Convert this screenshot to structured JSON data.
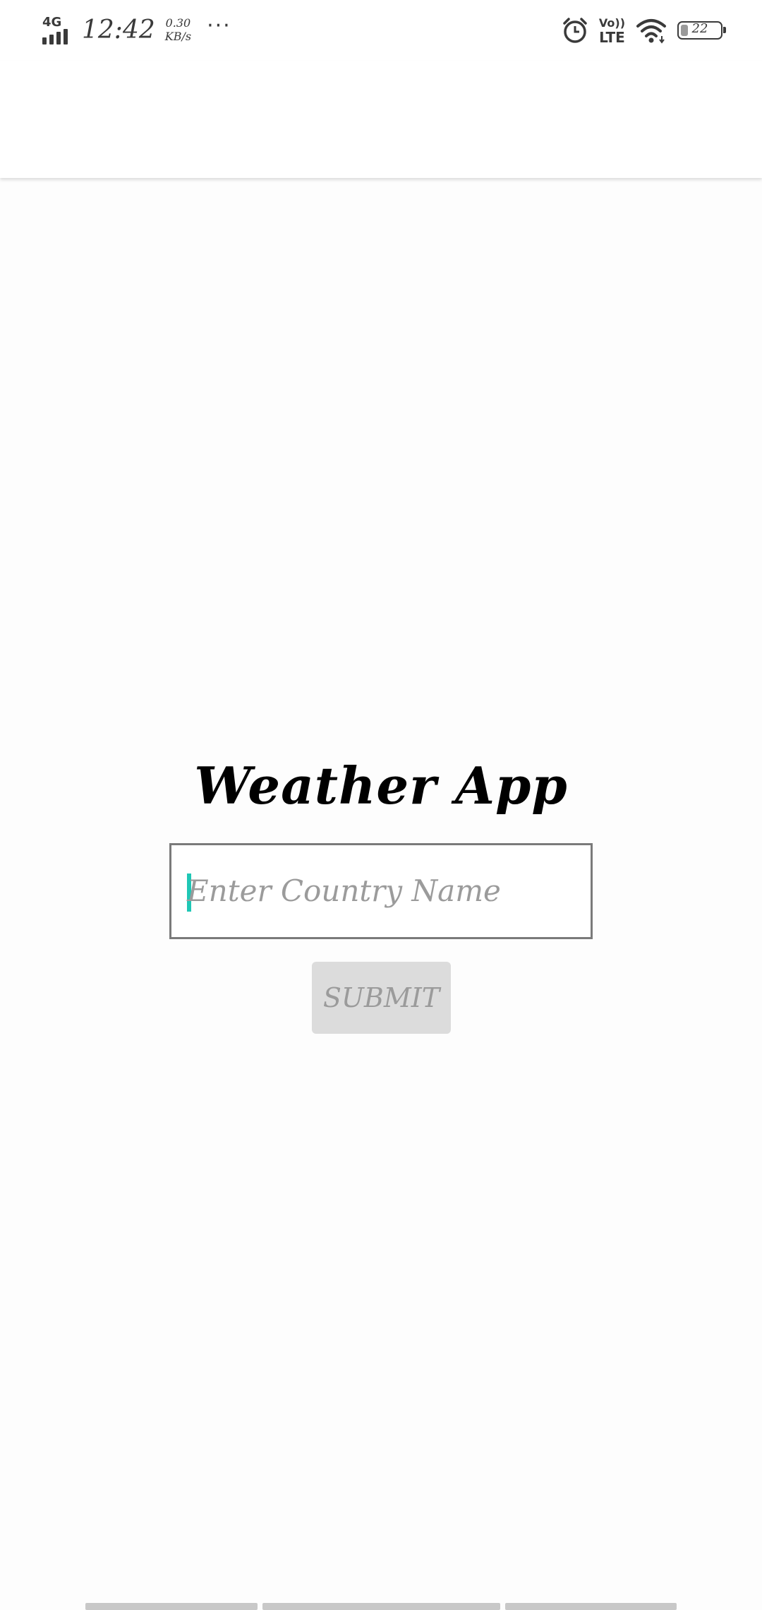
{
  "status_bar": {
    "network_type": "4G",
    "time": "12:42",
    "net_speed_value": "0.30",
    "net_speed_unit": "KB/s",
    "more_indicator": "···",
    "volte_top": "Vo))",
    "volte_bottom": "LTE",
    "battery_level": "22",
    "icons": [
      "signal-icon",
      "alarm-icon",
      "volte-icon",
      "wifi-icon",
      "battery-icon"
    ]
  },
  "main": {
    "title": "Weather App",
    "input": {
      "placeholder": "Enter Country Name",
      "value": ""
    },
    "submit_label": "SUBMIT"
  },
  "colors": {
    "cursor": "#1fc7b5",
    "button_bg": "#dcdcdc",
    "placeholder_text": "#9b9b9b",
    "input_border": "#7a7a7a"
  }
}
